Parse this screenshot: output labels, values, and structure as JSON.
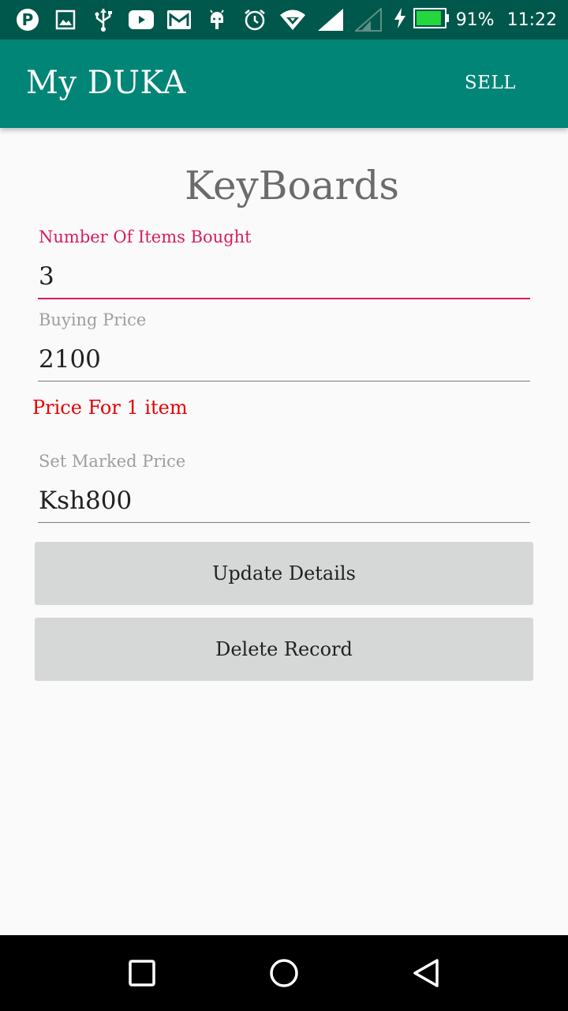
{
  "status_bar": {
    "battery": "91%",
    "time": "11:22",
    "icons": [
      "pinterest-icon",
      "gallery-icon",
      "usb-icon",
      "youtube-icon",
      "gmail-icon",
      "android-icon",
      "alarm-icon",
      "wifi-icon",
      "signal-icon",
      "signal-empty-icon",
      "charging-icon",
      "battery-icon"
    ],
    "battery_color": "#23d73d"
  },
  "app_bar": {
    "title": "My DUKA",
    "action": "SELL",
    "color": "#008577",
    "status_color": "#00574b"
  },
  "main": {
    "heading": "KeyBoards",
    "items_label": "Number Of Items Bought",
    "items_value": "3",
    "buying_label": "Buying Price",
    "buying_value": "2100",
    "note": "Price For 1 item",
    "marked_label": "Set Marked Price",
    "marked_value": "Ksh800",
    "update_button": "Update Details",
    "delete_button": "Delete Record",
    "accent": "#d81b60"
  },
  "nav_bar": {
    "icons": [
      "recents-icon",
      "home-icon",
      "back-icon"
    ]
  }
}
